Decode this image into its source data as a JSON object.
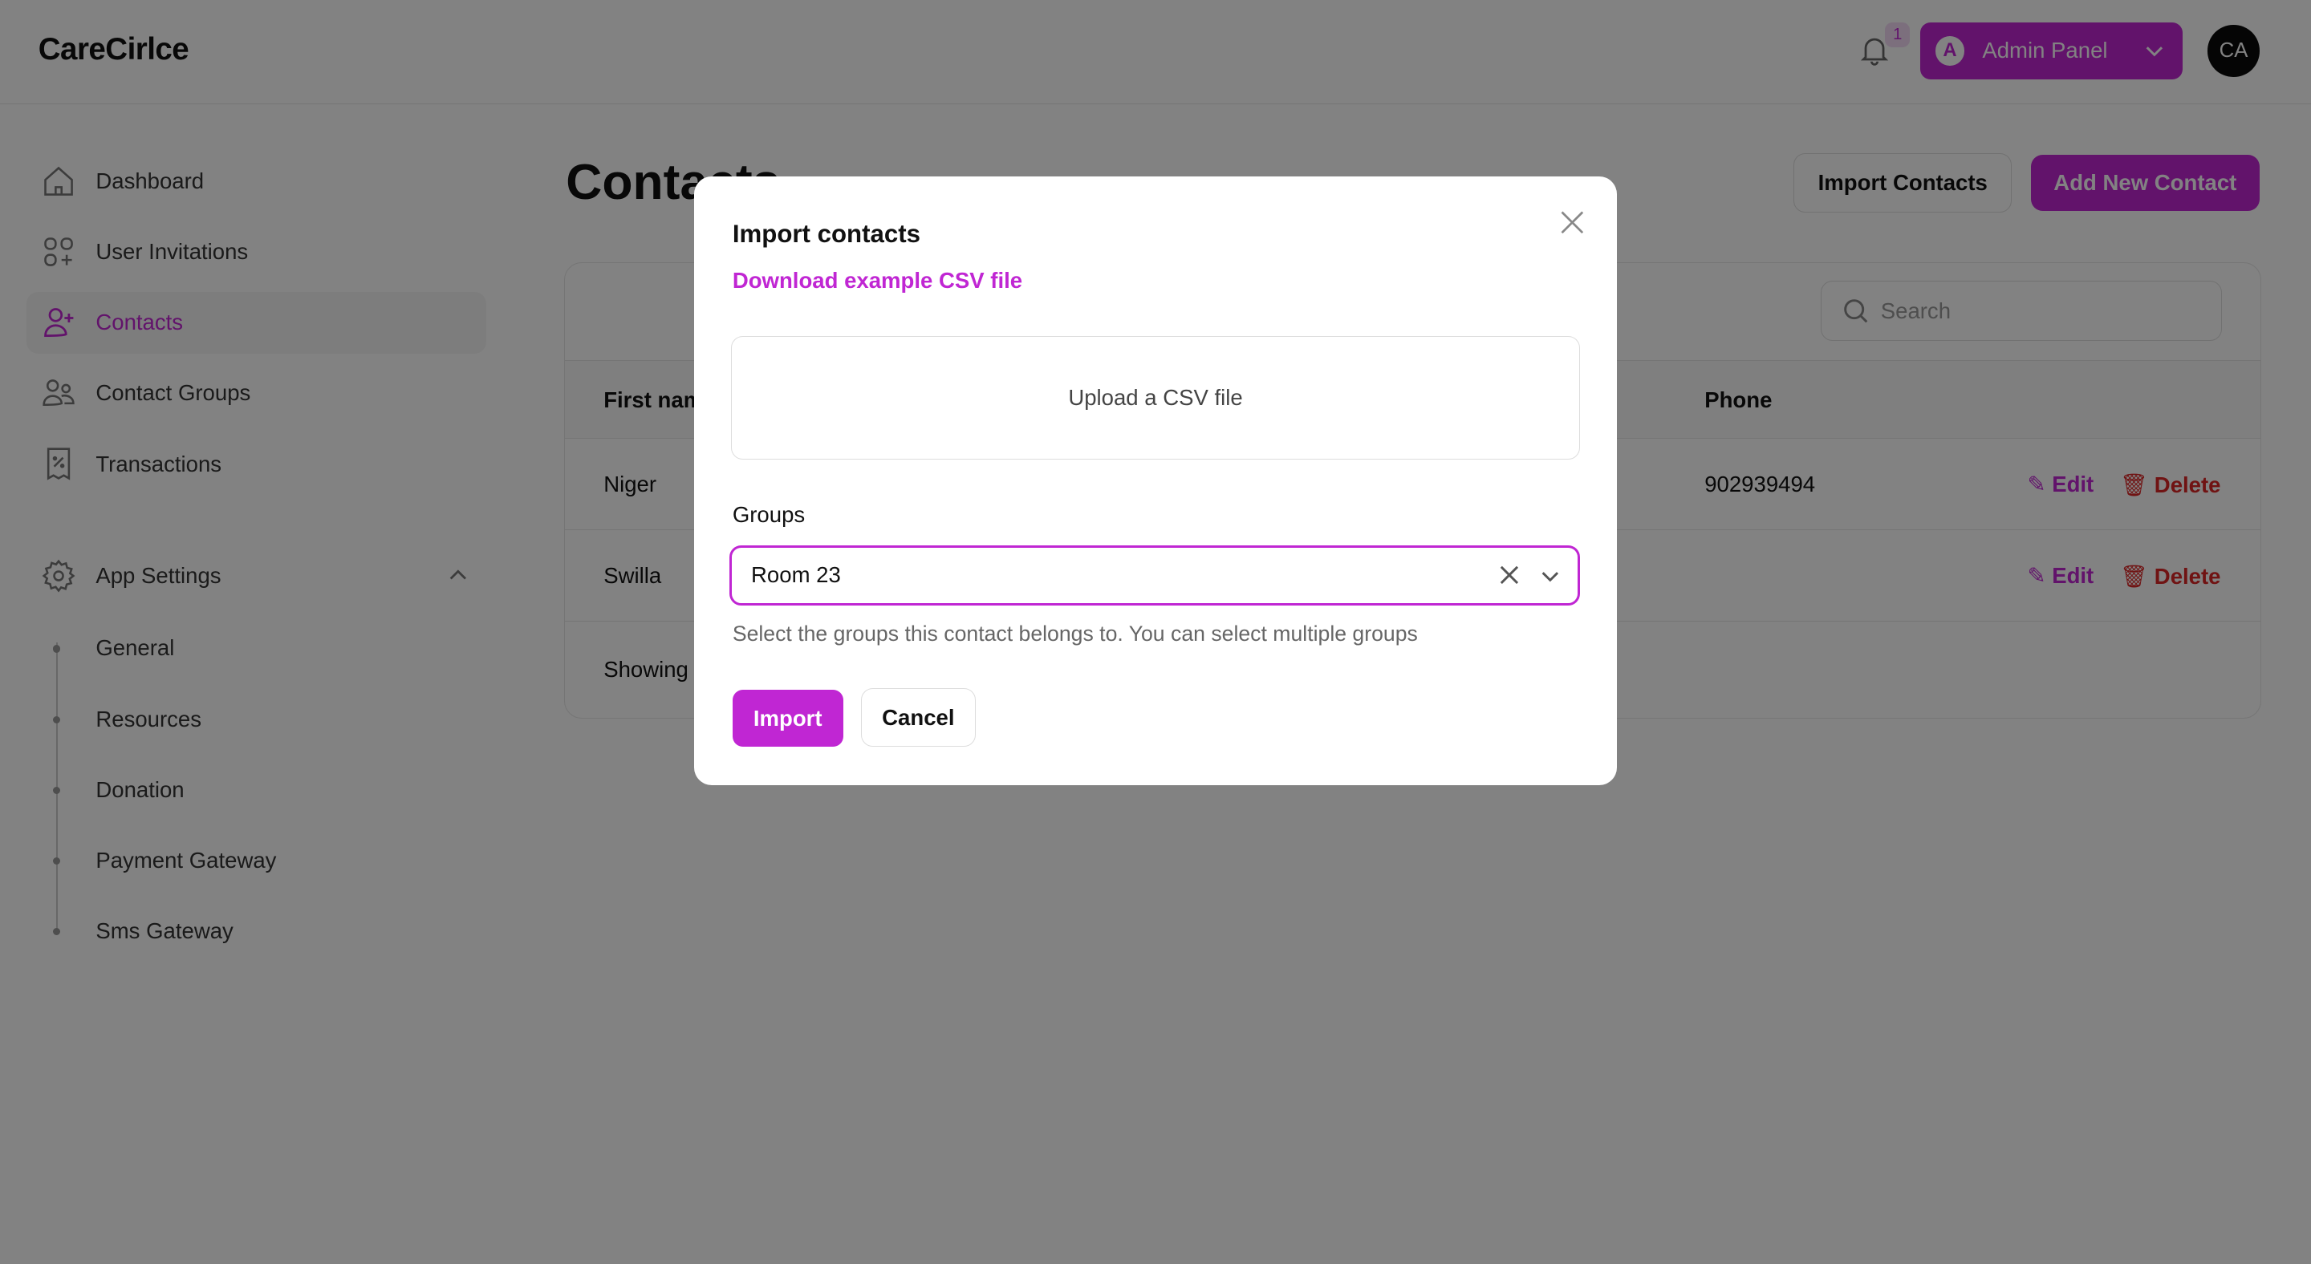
{
  "header": {
    "logo": "CareCirlce",
    "notification_count": "1",
    "admin_initial": "A",
    "admin_label": "Admin Panel",
    "avatar": "CA"
  },
  "sidebar": {
    "items": [
      {
        "label": "Dashboard",
        "icon": "home-icon"
      },
      {
        "label": "User Invitations",
        "icon": "apps-add-icon"
      },
      {
        "label": "Contacts",
        "icon": "user-plus-icon",
        "active": true
      },
      {
        "label": "Contact Groups",
        "icon": "users-icon"
      },
      {
        "label": "Transactions",
        "icon": "receipt-percent-icon"
      }
    ],
    "settings": {
      "label": "App Settings",
      "expanded": true,
      "items": [
        "General",
        "Resources",
        "Donation",
        "Payment Gateway",
        "Sms Gateway"
      ]
    }
  },
  "main": {
    "title": "Contacts",
    "import_button": "Import Contacts",
    "add_button": "Add New Contact",
    "search_placeholder": "Search",
    "table": {
      "headers": [
        "First name",
        "Phone"
      ],
      "rows": [
        {
          "first": "Niger",
          "phone": "902939494"
        },
        {
          "first": "Swilla",
          "phone": ""
        }
      ],
      "edit": "Edit",
      "delete": "Delete",
      "footer": "Showing"
    }
  },
  "modal": {
    "title": "Import contacts",
    "download_link": "Download example CSV file",
    "upload_label": "Upload a CSV file",
    "groups_label": "Groups",
    "groups_value": "Room 23",
    "hint": "Select the groups this contact belongs to. You can select multiple groups",
    "import_button": "Import",
    "cancel_button": "Cancel"
  },
  "colors": {
    "brand": "#c026d3",
    "danger": "#dc2626"
  }
}
